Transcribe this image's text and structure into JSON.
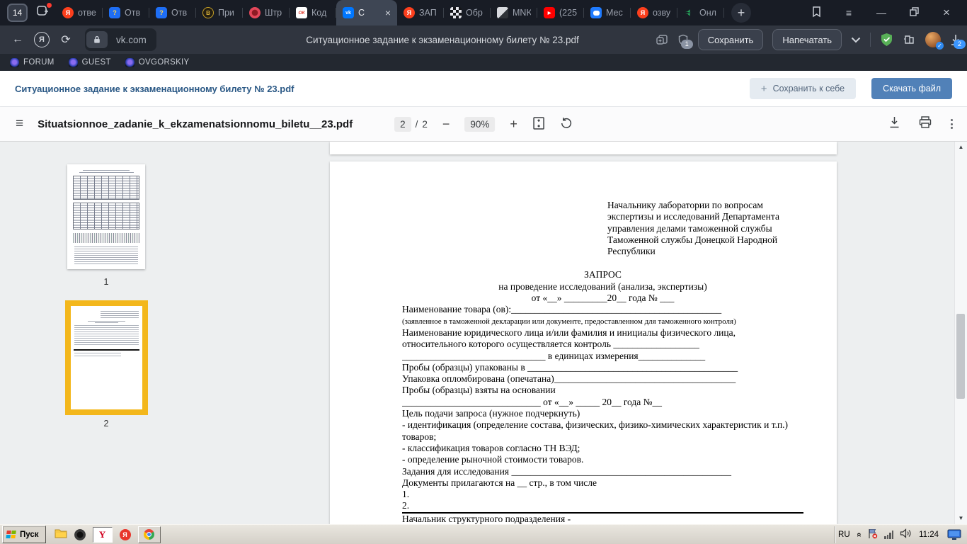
{
  "window": {
    "tab_count": "14",
    "page_title": "Ситуационное задание к экзаменационному билету № 23.pdf"
  },
  "icons": {
    "favicon_glyphs": {
      "yandex": "Я",
      "question": "?",
      "coin": "В",
      "ok": "ОК",
      "vk": "vk",
      "youtube": "▶"
    }
  },
  "tabs": [
    {
      "label": "отве",
      "icon": "yandex"
    },
    {
      "label": "Отв",
      "icon": "question"
    },
    {
      "label": "Отв",
      "icon": "question"
    },
    {
      "label": "При",
      "icon": "coin"
    },
    {
      "label": "Штр",
      "icon": "red-circle"
    },
    {
      "label": "Код",
      "icon": "ok"
    },
    {
      "label": "С",
      "icon": "vk",
      "active": true
    },
    {
      "label": "ЗАП",
      "icon": "yandex"
    },
    {
      "label": "Обр",
      "icon": "checker"
    },
    {
      "label": "MNK",
      "icon": "photo"
    },
    {
      "label": "(225",
      "icon": "youtube"
    },
    {
      "label": "Мес",
      "icon": "chat"
    },
    {
      "label": "озву",
      "icon": "yandex"
    },
    {
      "label": "Онл",
      "icon": "speaker"
    }
  ],
  "addressbar": {
    "url": "vk.com",
    "save_label": "Сохранить",
    "print_label": "Напечатать",
    "shield_badge": "1",
    "download_badge": "2"
  },
  "bookmarks": [
    {
      "label": "FORUM"
    },
    {
      "label": "GUEST"
    },
    {
      "label": "OVGORSKIY"
    }
  ],
  "vk": {
    "doc_title": "Ситуационное задание к экзаменационному билету № 23.pdf",
    "save_button": "Сохранить к себе",
    "download_button": "Скачать файл",
    "accent_blue": "#5181b8"
  },
  "viewer": {
    "filename": "Situatsionnoe_zadanie_k_ekzamenatsionnomu_biletu__23.pdf",
    "page_current": "2",
    "page_separator": "/",
    "page_total": "2",
    "zoom_level": "90%",
    "selection_color": "#f3b71c"
  },
  "thumbnails": [
    {
      "label": "1",
      "selected": false
    },
    {
      "label": "2",
      "selected": true
    }
  ],
  "document": {
    "recipient": [
      "Начальнику лаборатории по вопросам",
      "экспертизы и исследований Департамента",
      "управления делами таможенной службы",
      "Таможенной службы Донецкой Народной",
      "Республики"
    ],
    "center": [
      "ЗАПРОС",
      "на проведение исследований (анализа, экспертизы)",
      "от «__» _________20__ года № ___"
    ],
    "lines": [
      {
        "text": "Наименование товара (ов):____________________________________________"
      },
      {
        "text": " (заявленное в таможенной декларации или документе, предоставленном для таможенного контроля)",
        "small": true
      },
      {
        "text": "Наименование юридического лица и/или фамилия и инициалы физического лица,"
      },
      {
        "text": "относительного которого осуществляется контроль __________________"
      },
      {
        "text": "______________________________ в единицах измерения______________"
      },
      {
        "text": "Пробы (образцы) упакованы в ____________________________________________"
      },
      {
        "text": "Упаковка опломбирована (опечатана)______________________________________"
      },
      {
        "text": "Пробы (образцы) взяты на основании"
      },
      {
        "text": "_____________________________ от «__» _____ 20__ года №__"
      },
      {
        "text": "Цель подачи запроса (нужное подчеркнуть)"
      },
      {
        "text": "- идентификация (определение состава, физических, физико-химических характеристик и т.п.) товаров;",
        "wrap": true
      },
      {
        "text": "- классификация товаров согласно ТН ВЭД;"
      },
      {
        "text": "- определение рыночной стоимости товаров."
      },
      {
        "text": "Задания для исследования ______________________________________________"
      },
      {
        "text": "Документы прилагаются на __ стр., в том числе"
      },
      {
        "text": "1."
      },
      {
        "text": "2.",
        "rule": true
      },
      {
        "text": "Начальник структурного подразделения -"
      }
    ]
  },
  "taskbar": {
    "start_label": "Пуск",
    "language": "RU",
    "time": "11:24"
  }
}
